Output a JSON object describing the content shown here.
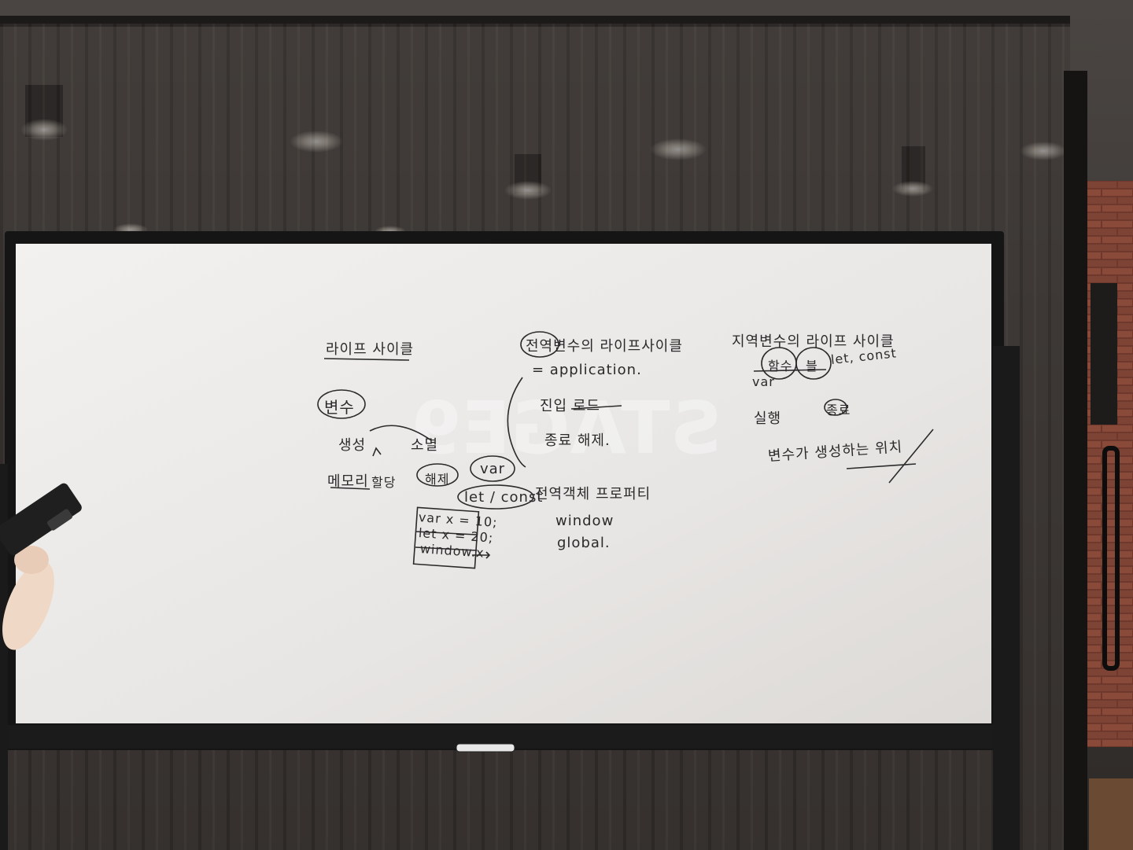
{
  "colors": {
    "wall": "#2b2624",
    "curtain": "#3a3533",
    "board": "#eceae8",
    "frame": "#141414",
    "ink": "#2a2a2a",
    "brick": "#7a3f32"
  },
  "board_notes": {
    "left": {
      "header": "라이프 사이클",
      "variable": "변수",
      "create": "생성",
      "destroy": "소멸",
      "memory": "메모리",
      "allocate": "할당",
      "release": "해제",
      "var": "var",
      "let_const": "let / const",
      "code1": "var x = 10;",
      "code2": "let x = 20;",
      "code3": "window.x"
    },
    "middle": {
      "header": "전역변수의 라이프사이클",
      "application": "= application.",
      "enter": "진입 로드",
      "end": "종료 해제.",
      "global_object": "전역객체 프로퍼티",
      "window": "window",
      "global": "global."
    },
    "right": {
      "header": "지역변수의 라이프 사이클",
      "var_label": "var",
      "func": "함수",
      "block": "블",
      "let_const": "let, const",
      "execution": "실행",
      "end": "종료",
      "note": "변수가 생성하는 위치"
    }
  }
}
